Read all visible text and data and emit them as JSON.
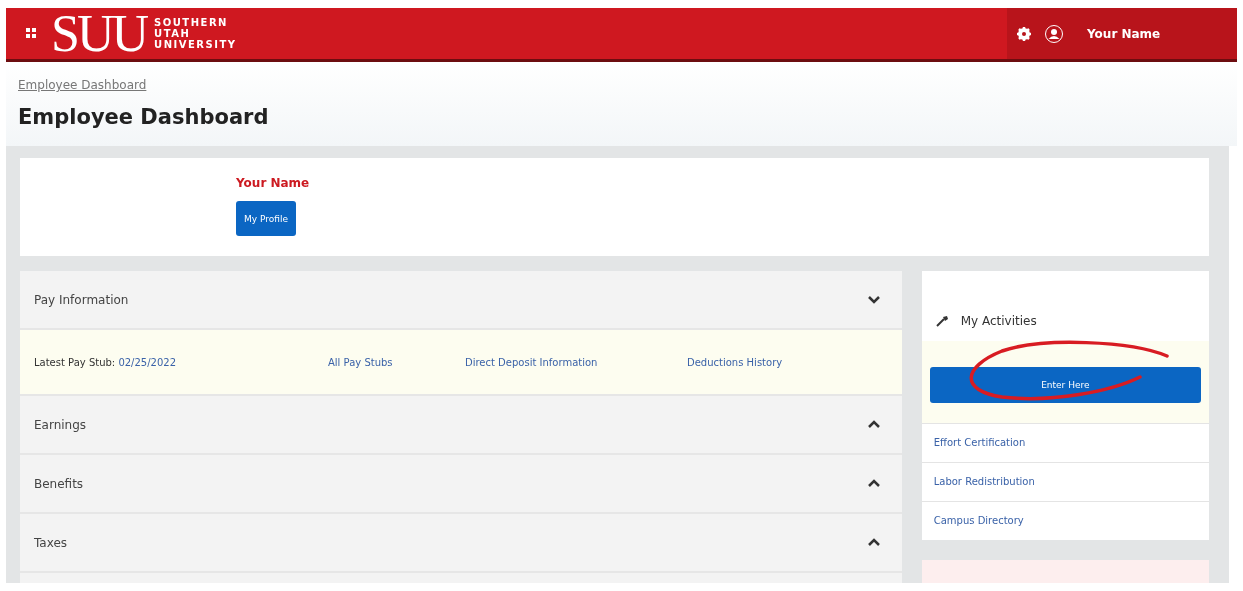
{
  "header": {
    "logo_mark": "SUU",
    "logo_words": [
      "SOUTHERN",
      "UTAH",
      "UNIVERSITY"
    ],
    "user_name": "Your Name"
  },
  "breadcrumb": "Employee Dashboard",
  "page_title": "Employee Dashboard",
  "profile": {
    "name": "Your Name",
    "button": "My Profile"
  },
  "sections": [
    {
      "title": "Pay Information",
      "expanded": true,
      "links": [
        {
          "label": "Latest Pay Stub:",
          "value": "02/25/2022"
        },
        {
          "label": "All Pay Stubs"
        },
        {
          "label": "Direct Deposit Information"
        },
        {
          "label": "Deductions History"
        }
      ]
    },
    {
      "title": "Earnings",
      "expanded": false
    },
    {
      "title": "Benefits",
      "expanded": false
    },
    {
      "title": "Taxes",
      "expanded": false
    }
  ],
  "activities": {
    "title": "My Activities",
    "button": "Enter Here",
    "annotated": true,
    "links": [
      "Effort Certification",
      "Labor Redistribution",
      "Campus Directory"
    ]
  }
}
